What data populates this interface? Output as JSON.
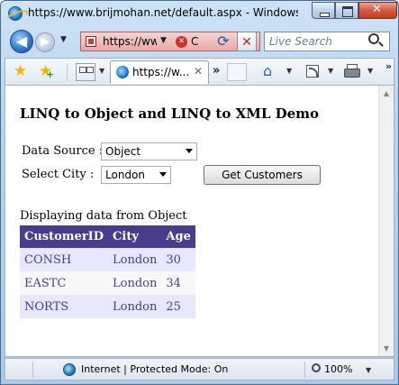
{
  "window": {
    "title": "https://www.brijmohan.net/default.aspx - Windows Internet Explorer"
  },
  "nav": {
    "address_text": "https://ww",
    "cert_text": "C",
    "search_placeholder": "Live Search"
  },
  "tabs": [
    {
      "label": "https://w...",
      "close": "✕"
    }
  ],
  "toolbar": {
    "more_tabs": "»",
    "more_commands": "»"
  },
  "page": {
    "heading": "LINQ to Object and LINQ to XML Demo",
    "data_source_label": "Data Source :",
    "data_source_value": "Object",
    "select_city_label": "Select City :",
    "select_city_value": "London",
    "get_customers_button": "Get Customers",
    "caption": "Displaying data from Object",
    "table": {
      "headers": [
        "CustomerID",
        "City",
        "Age"
      ],
      "rows": [
        [
          "CONSH",
          "London",
          "30"
        ],
        [
          "EASTC",
          "London",
          "34"
        ],
        [
          "NORTS",
          "London",
          "25"
        ]
      ]
    }
  },
  "status": {
    "zone_text": "Internet | Protected Mode: On",
    "zoom": "100%"
  },
  "colors": {
    "grid_header": "#4a3c8c",
    "grid_odd_row": "#e7e7ff",
    "grid_even_row": "#f7f7f7"
  }
}
